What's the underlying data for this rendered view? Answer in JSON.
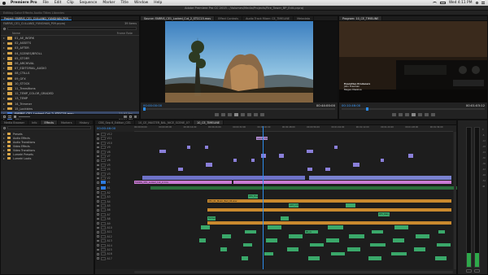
{
  "menubar": {
    "items": [
      {
        "label": "Premiere Pro",
        "bold": true
      },
      {
        "label": "File"
      },
      {
        "label": "Edit"
      },
      {
        "label": "Clip"
      },
      {
        "label": "Sequence"
      },
      {
        "label": "Marker"
      },
      {
        "label": "Title"
      },
      {
        "label": "Window"
      },
      {
        "label": "Help"
      }
    ],
    "clock": "Wed 4:11 PM"
  },
  "app_title": "Adobe Premiere Pro CC 2015 - /Volumes/Media/Projects/Fire_Tower_BP_Edit.prproj",
  "workspaces": "Editing   Color   Effects   Audio   Titles   Libraries",
  "project": {
    "tab": "Project: FARRIS_CE1_CULLAND_YUNGHAN_P09",
    "name": "FARRIS_CE1_CULLAND_YUNGHAN_P09.prproj",
    "count": "39 Items",
    "col_name": "Name",
    "col_fps": "Frame Rate",
    "items": [
      {
        "label": "01_AE_WORK",
        "color": "#d9a64a"
      },
      {
        "label": "02_ASSETS",
        "color": "#d9a64a"
      },
      {
        "label": "03_AFTER",
        "color": "#d9a64a"
      },
      {
        "label": "04_SCENES/BROLL",
        "color": "#d9a64a"
      },
      {
        "label": "05_STORY",
        "color": "#d9a64a"
      },
      {
        "label": "06_ARCHIVAL",
        "color": "#d9a64a"
      },
      {
        "label": "07_EDITORIAL_AUDIO",
        "color": "#d9a64a"
      },
      {
        "label": "08_CTILLS",
        "color": "#d9a64a"
      },
      {
        "label": "09_GFX",
        "color": "#d9a64a"
      },
      {
        "label": "10_STOCK",
        "color": "#d9a64a"
      },
      {
        "label": "11_Transitions",
        "color": "#d9a64a"
      },
      {
        "label": "12_TEMP_COLOR_GRADED",
        "color": "#d9a64a"
      },
      {
        "label": "13_TEMP",
        "color": "#d9a64a"
      },
      {
        "label": "14_Trimmer",
        "color": "#d9a64a"
      },
      {
        "label": "15_Lockbins",
        "color": "#d9a64a"
      },
      {
        "label": "FARRIS_CE1_Locked_Cut_2_STCC15.mov",
        "fps": "23.97 fps",
        "selected": true,
        "color": "#4a7fd9"
      },
      {
        "label": "Trim",
        "fps": "23.97 fps",
        "color": "#4a7fd9"
      },
      {
        "label": "aMapset",
        "fps": "",
        "color": "#d9a64a"
      }
    ]
  },
  "source": {
    "tabs": [
      "Source: FARRIS_CE1_Locked_Cut_2_STCC15.mov",
      "Effect Controls",
      "Audio Track Mixer: CE_TIMELINE",
      "Metadata"
    ],
    "tc_in": "00:00:00:00",
    "tc_out": "00:44:00:00"
  },
  "program": {
    "tab": "Program: 10_CE_TIMELINE",
    "credits": [
      "Executive Producers",
      "John Freeman",
      "Megan Mazzina"
    ],
    "tc_in": "00:10:46:00",
    "tc_out": "00:01:03:12"
  },
  "effects": {
    "tabs": [
      "Media Browser",
      "Info",
      "Effects",
      "Markers",
      "History"
    ],
    "search_placeholder": "",
    "items": [
      "Presets",
      "Audio Effects",
      "Audio Transitions",
      "Video Effects",
      "Video Transitions",
      "Lumetri Presets",
      "Lumetri Looks"
    ]
  },
  "timeline": {
    "tabs": [
      "CBS_Sep 6_Edition_CE1",
      "10_CE_MASTER_BAL_NICE_SCENE_07",
      "10_CE_TIMELINE"
    ],
    "timecode": "00:00:46:00",
    "ruler": [
      "00:00:00:00",
      "00:00:08:00",
      "00:00:16:00",
      "00:00:24:00",
      "00:00:32:00",
      "00:00:40:00",
      "00:00:48:00",
      "00:00:56:00",
      "00:01:04:00",
      "00:01:12:00",
      "00:01:20:00",
      "00:01:28:00",
      "00:01:36:00"
    ],
    "video_tracks": [
      "V12",
      "V11",
      "V10",
      "V9",
      "V8",
      "V7",
      "V6",
      "V5",
      "V4",
      "V3",
      "V2",
      "V1"
    ],
    "audio_tracks": [
      "A1",
      "A2",
      "A3",
      "A4",
      "A5",
      "A6",
      "A7",
      "A8",
      "A9",
      "A10",
      "A11",
      "A12",
      "A13",
      "A14",
      "A15",
      "A16",
      "A17"
    ],
    "title_clip": "Laurel Title",
    "main_clip": "FARRIS_CE1_Locked_Cut_2.mov",
    "clip_names": [
      "CE1_01_Music_Bed_04.wav",
      "A03_Intro_Rich",
      "Farmer_Rain",
      "Pit_Crowd_RAW",
      "SFX_Fire",
      "SFX_Rain_Sweep"
    ]
  },
  "colors": {
    "accent_blue": "#2d8ceb",
    "video_clip": "#8a7fd9",
    "main_clip": "#c97ad4",
    "audio_green": "#3aa86a",
    "audio_orange": "#c9892e",
    "selected_blue": "#4a7fd9"
  }
}
